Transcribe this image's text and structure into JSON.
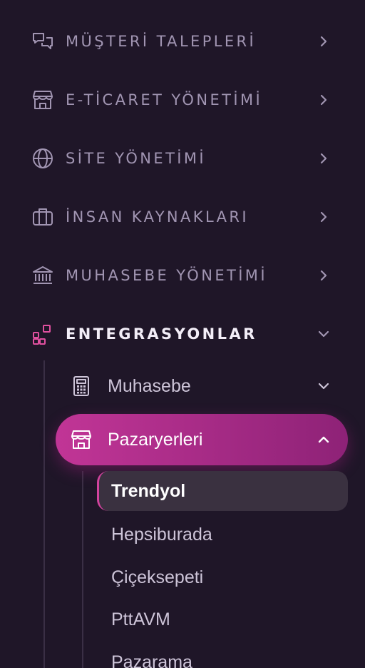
{
  "menu": {
    "items": [
      {
        "label": "MÜŞTERİ TALEPLERİ",
        "icon": "chat-bubbles-icon",
        "expanded": false
      },
      {
        "label": "E-TİCARET YÖNETİMİ",
        "icon": "storefront-icon",
        "expanded": false
      },
      {
        "label": "SİTE YÖNETİMİ",
        "icon": "globe-icon",
        "expanded": false
      },
      {
        "label": "İNSAN KAYNAKLARI",
        "icon": "briefcase-icon",
        "expanded": false
      },
      {
        "label": "MUHASEBE YÖNETİMİ",
        "icon": "bank-icon",
        "expanded": false
      },
      {
        "label": "ENTEGRASYONLAR",
        "icon": "apps-grid-icon",
        "expanded": true
      }
    ]
  },
  "integrations": {
    "children": [
      {
        "label": "Muhasebe",
        "icon": "calculator-icon",
        "expanded": false
      },
      {
        "label": "Pazaryerleri",
        "icon": "storefront-icon",
        "expanded": true
      }
    ],
    "marketplaces": [
      {
        "label": "Trendyol",
        "selected": true
      },
      {
        "label": "Hepsiburada",
        "selected": false
      },
      {
        "label": "Çiçeksepeti",
        "selected": false
      },
      {
        "label": "PttAVM",
        "selected": false
      },
      {
        "label": "Pazarama",
        "selected": false
      }
    ]
  },
  "colors": {
    "background": "#1f1628",
    "accent": "#c13596",
    "accent_icon": "#e0509f",
    "selected_bg": "#3a3140",
    "muted_text": "#a195b2"
  }
}
